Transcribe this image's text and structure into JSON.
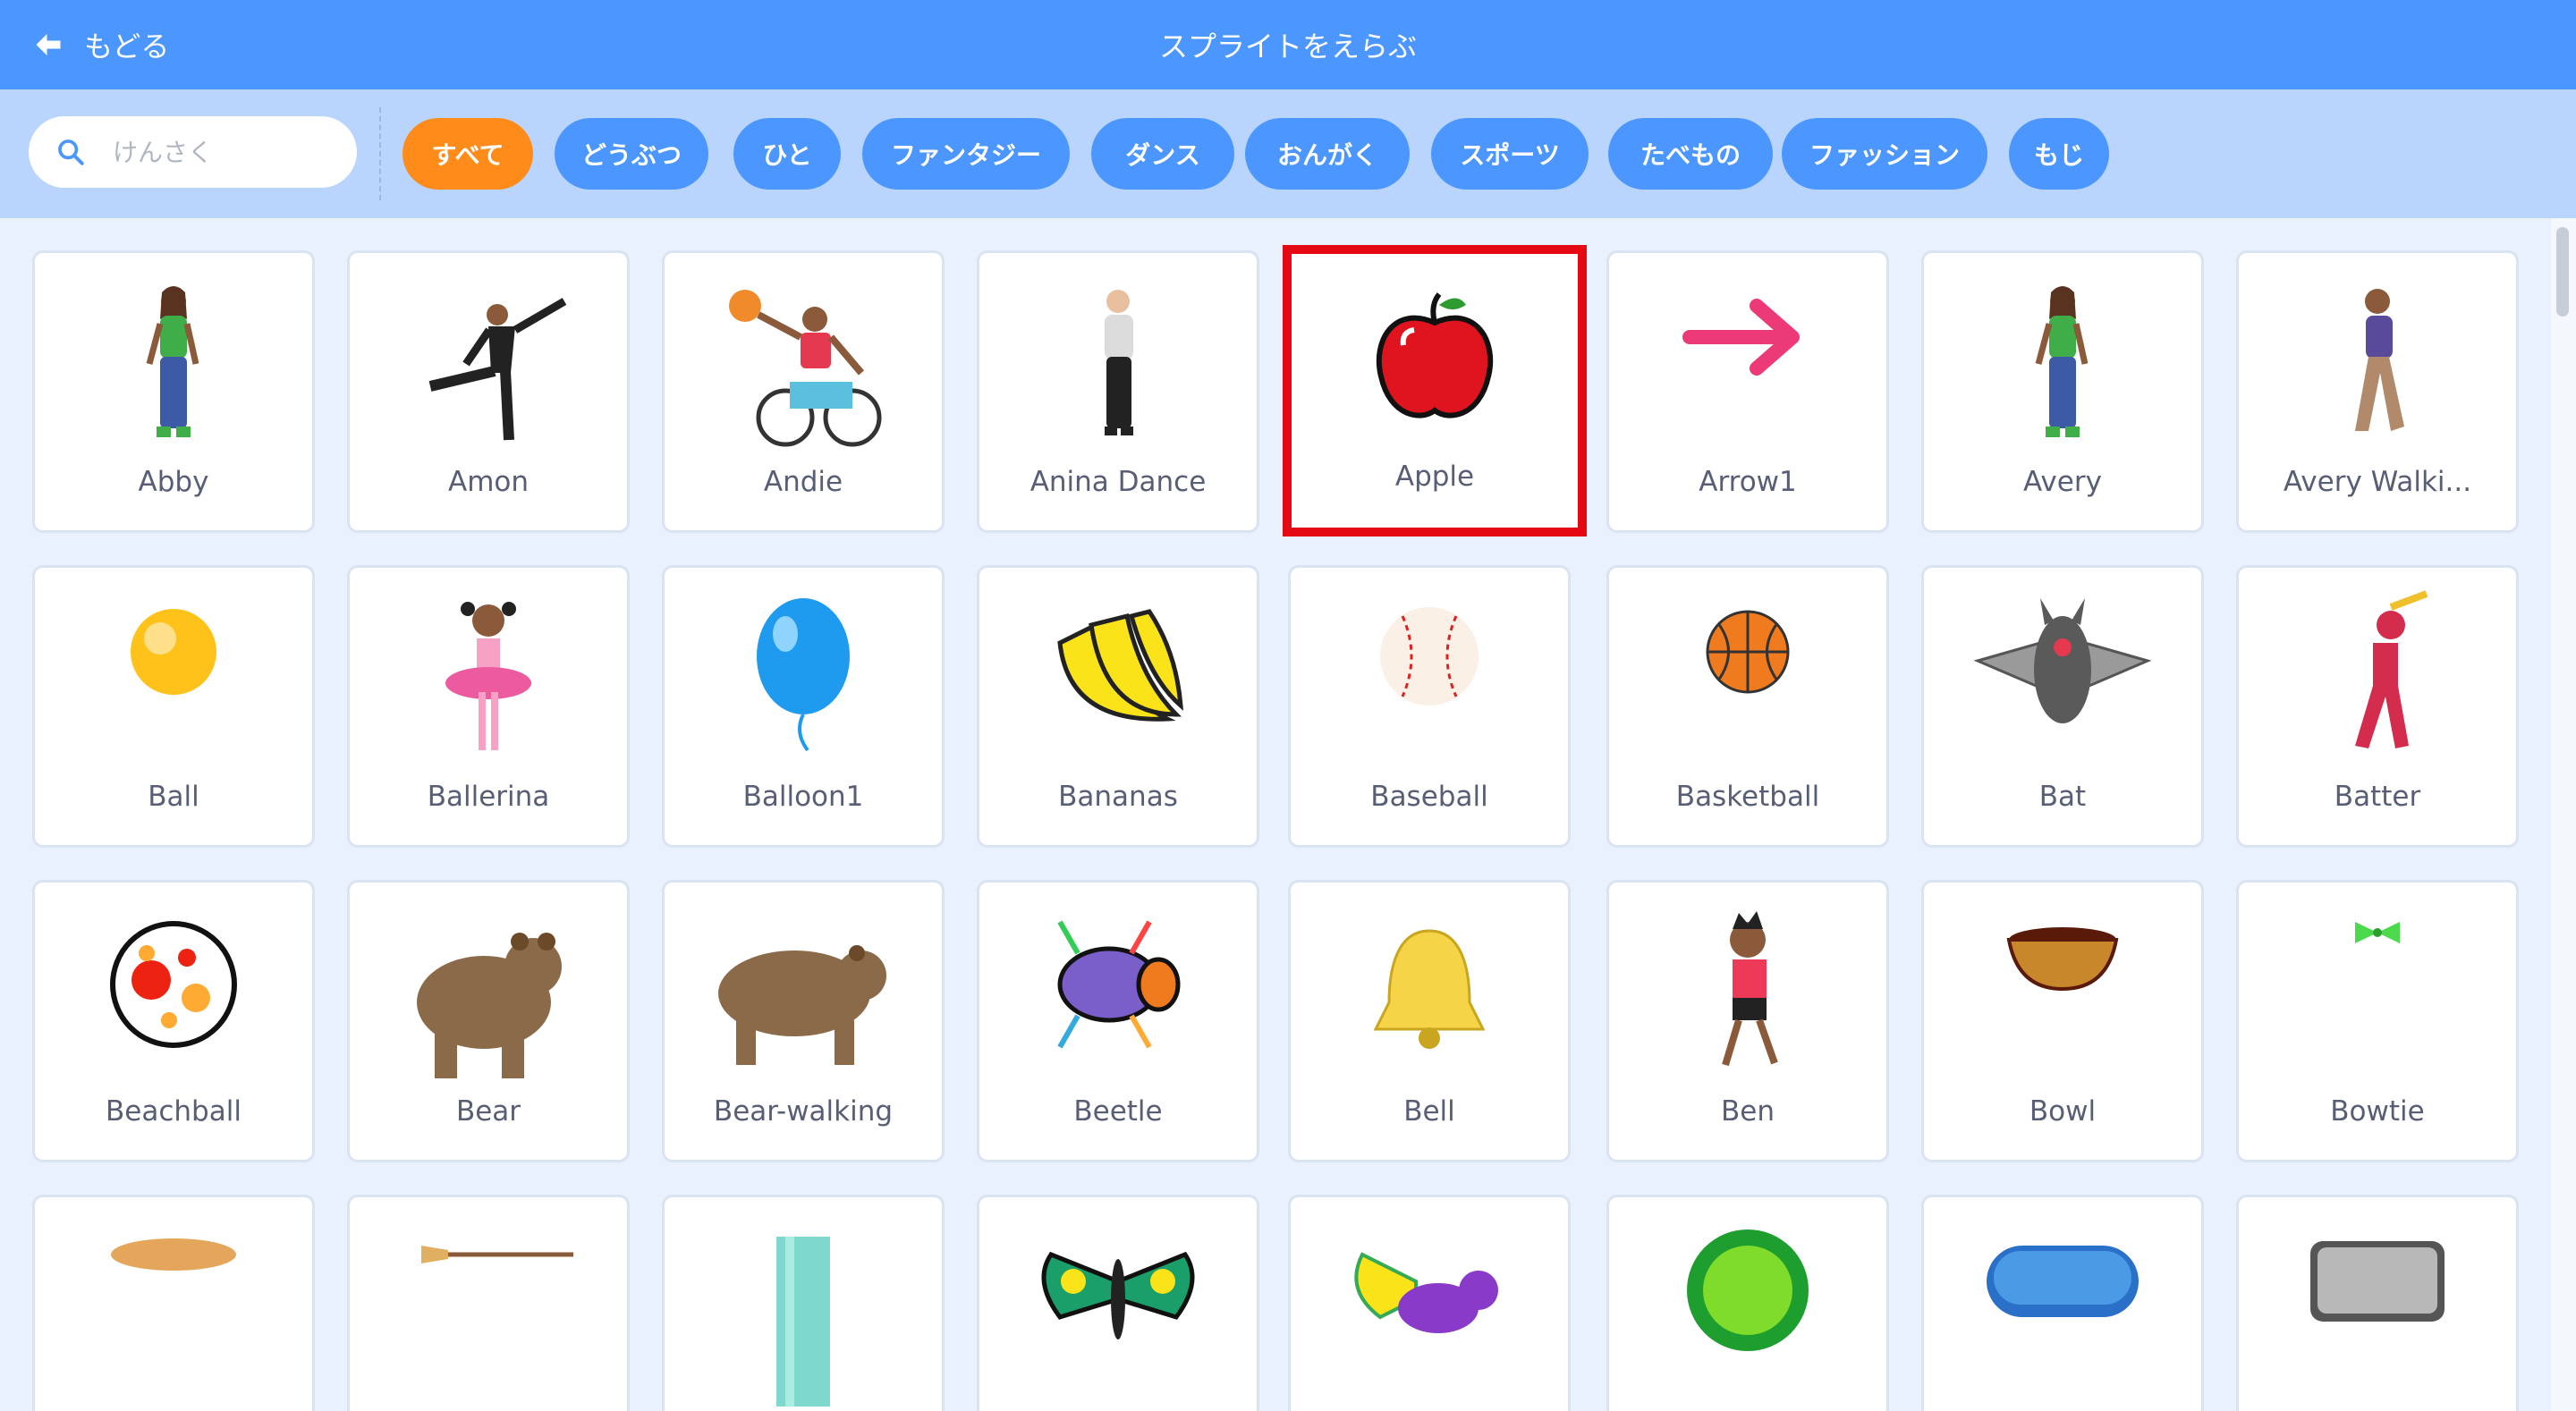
{
  "header": {
    "back_label": "もどる",
    "title": "スプライトをえらぶ"
  },
  "search": {
    "placeholder": "けんさく",
    "value": ""
  },
  "tags": [
    {
      "label": "すべて",
      "active": true
    },
    {
      "label": "どうぶつ",
      "active": false
    },
    {
      "label": "ひと",
      "active": false
    },
    {
      "label": "ファンタジー",
      "active": false
    },
    {
      "label": "ダンス",
      "active": false
    },
    {
      "label": "おんがく",
      "active": false
    },
    {
      "label": "スポーツ",
      "active": false
    },
    {
      "label": "たべもの",
      "active": false
    },
    {
      "label": "ファッション",
      "active": false
    },
    {
      "label": "もじ",
      "active": false
    }
  ],
  "sprites": [
    {
      "name": "Abby",
      "icon": "girl-icon"
    },
    {
      "name": "Amon",
      "icon": "dancer-icon"
    },
    {
      "name": "Andie",
      "icon": "wheelchair-basketball-icon"
    },
    {
      "name": "Anina Dance",
      "icon": "dancer-girl-icon"
    },
    {
      "name": "Apple",
      "icon": "apple-icon",
      "selected": true
    },
    {
      "name": "Arrow1",
      "icon": "arrow-icon"
    },
    {
      "name": "Avery",
      "icon": "girl-icon"
    },
    {
      "name": "Avery Walki...",
      "icon": "walking-girl-icon"
    },
    {
      "name": "Ball",
      "icon": "ball-icon"
    },
    {
      "name": "Ballerina",
      "icon": "ballerina-icon"
    },
    {
      "name": "Balloon1",
      "icon": "balloon-icon"
    },
    {
      "name": "Bananas",
      "icon": "bananas-icon"
    },
    {
      "name": "Baseball",
      "icon": "baseball-icon"
    },
    {
      "name": "Basketball",
      "icon": "basketball-icon"
    },
    {
      "name": "Bat",
      "icon": "bat-icon"
    },
    {
      "name": "Batter",
      "icon": "batter-icon"
    },
    {
      "name": "Beachball",
      "icon": "beachball-icon"
    },
    {
      "name": "Bear",
      "icon": "bear-icon"
    },
    {
      "name": "Bear-walking",
      "icon": "bear-walking-icon"
    },
    {
      "name": "Beetle",
      "icon": "beetle-icon"
    },
    {
      "name": "Bell",
      "icon": "bell-icon"
    },
    {
      "name": "Ben",
      "icon": "boy-running-icon"
    },
    {
      "name": "Bowl",
      "icon": "bowl-icon"
    },
    {
      "name": "Bowtie",
      "icon": "bowtie-icon"
    },
    {
      "name": "",
      "icon": "bread-icon"
    },
    {
      "name": "",
      "icon": "broom-icon"
    },
    {
      "name": "",
      "icon": "building-icon"
    },
    {
      "name": "",
      "icon": "butterfly-icon"
    },
    {
      "name": "",
      "icon": "butterfly-cat-icon"
    },
    {
      "name": "",
      "icon": "green-button-icon"
    },
    {
      "name": "",
      "icon": "blue-button-icon"
    },
    {
      "name": "",
      "icon": "gray-button-icon"
    }
  ],
  "colors": {
    "header": "#4c97ff",
    "filterbar": "#b9d5fd",
    "active_tag": "#ff8c1a",
    "selected_border": "#e50914",
    "label": "#575e75"
  }
}
